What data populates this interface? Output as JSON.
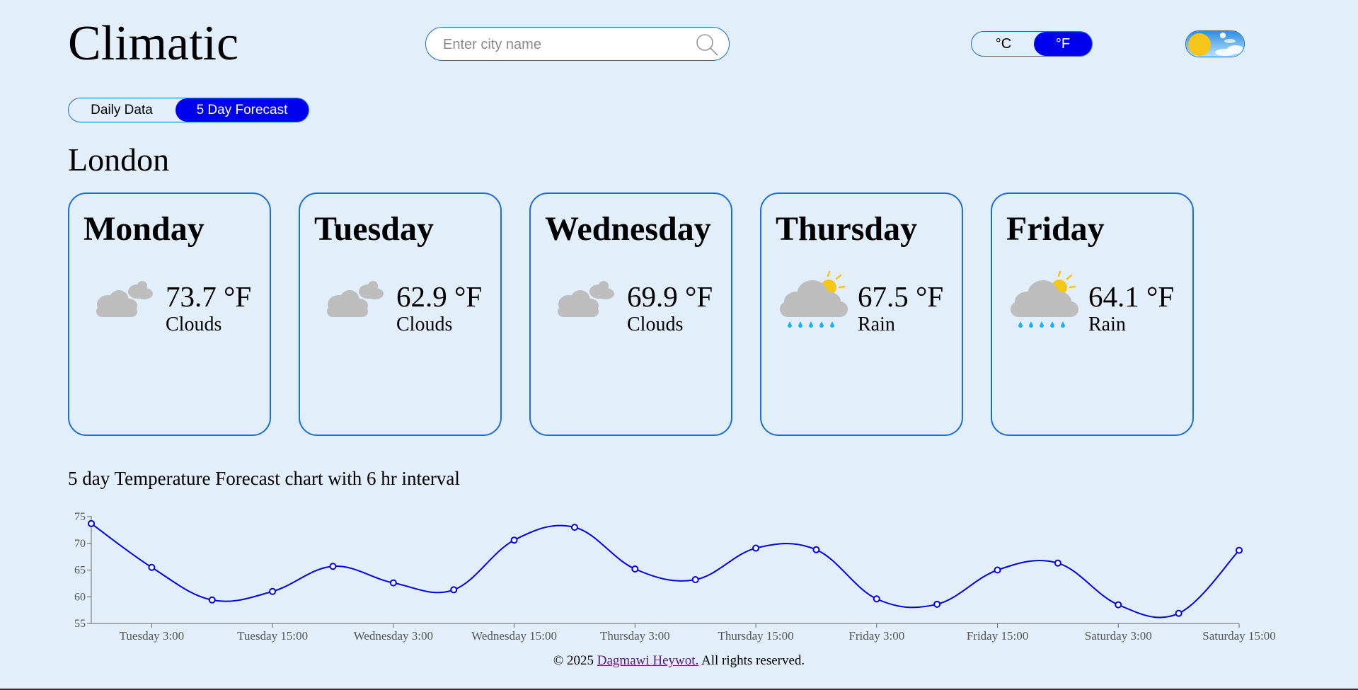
{
  "app": {
    "title": "Climatic"
  },
  "search": {
    "placeholder": "Enter city name"
  },
  "units": {
    "celsius": "°C",
    "fahrenheit": "°F",
    "selected": "fahrenheit"
  },
  "tabs": {
    "daily": "Daily Data",
    "forecast": "5 Day Forecast",
    "selected": "forecast"
  },
  "city": "London",
  "days": [
    {
      "name": "Monday",
      "temp": "73.7 °F",
      "desc": "Clouds",
      "icon": "clouds-icon"
    },
    {
      "name": "Tuesday",
      "temp": "62.9 °F",
      "desc": "Clouds",
      "icon": "clouds-icon"
    },
    {
      "name": "Wednesday",
      "temp": "69.9 °F",
      "desc": "Clouds",
      "icon": "clouds-icon"
    },
    {
      "name": "Thursday",
      "temp": "67.5 °F",
      "desc": "Rain",
      "icon": "rain-sun-icon"
    },
    {
      "name": "Friday",
      "temp": "64.1 °F",
      "desc": "Rain",
      "icon": "rain-sun-icon"
    }
  ],
  "chart_title": "5 day Temperature Forecast chart with 6 hr interval",
  "chart_data": {
    "type": "line",
    "title": "5 day Temperature Forecast chart with 6 hr interval",
    "xlabel": "",
    "ylabel": "",
    "ylim": [
      55,
      75
    ],
    "yticks": [
      55,
      60,
      65,
      70,
      75
    ],
    "x_tick_labels": [
      "Tuesday 3:00",
      "Tuesday 15:00",
      "Wednesday 3:00",
      "Wednesday 15:00",
      "Thursday 3:00",
      "Thursday 15:00",
      "Friday 3:00",
      "Friday 15:00",
      "Saturday 3:00",
      "Saturday 15:00"
    ],
    "series": [
      {
        "color": "#0000ee",
        "values": [
          73.7,
          65.5,
          59.4,
          61.0,
          65.7,
          62.6,
          61.3,
          70.6,
          73.0,
          65.2,
          63.2,
          69.1,
          68.8,
          59.6,
          58.6,
          65.0,
          66.3,
          58.5,
          56.9,
          68.7
        ]
      }
    ],
    "grid": false,
    "legend": "none"
  },
  "footer": {
    "prefix": "© 2025 ",
    "author": "Dagmawi Heywot.",
    "suffix": " All rights reserved."
  }
}
